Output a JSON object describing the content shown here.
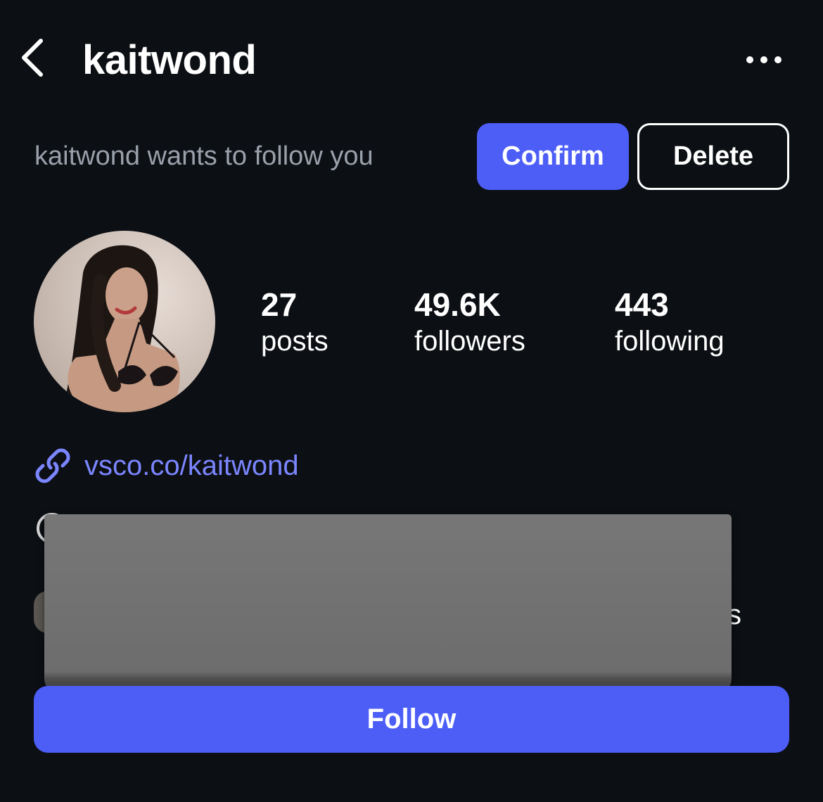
{
  "header": {
    "back_icon": "chevron-left-icon",
    "username": "kaitwond",
    "more_icon": "more-horizontal-icon"
  },
  "request": {
    "text": "kaitwond wants to follow you",
    "confirm_label": "Confirm",
    "delete_label": "Delete"
  },
  "profile": {
    "stats": [
      {
        "count": "27",
        "label": "posts"
      },
      {
        "count": "49.6K",
        "label": "followers"
      },
      {
        "count": "443",
        "label": "following"
      }
    ],
    "link_icon": "link-icon",
    "link": "vsco.co/kaitwond",
    "partial_text": "s"
  },
  "actions": {
    "follow_label": "Follow"
  },
  "colors": {
    "background": "#0c0f14",
    "accent": "#4d5ef7",
    "link": "#7b86ff",
    "muted_text": "#9aa0aa",
    "redaction": "#6f6f6f"
  }
}
